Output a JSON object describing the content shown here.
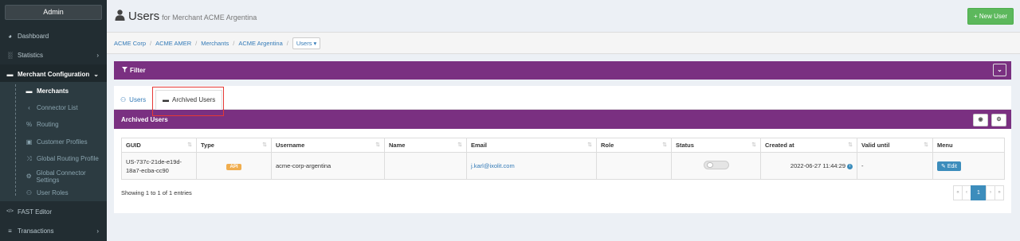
{
  "sidebar": {
    "admin_label": "Admin",
    "items": [
      {
        "label": "Dashboard",
        "icon": "dashboard-icon",
        "glyph": "◕"
      },
      {
        "label": "Statistics",
        "icon": "bar-chart-icon",
        "glyph": "░"
      },
      {
        "label": "Merchant Configuration",
        "icon": "folder-icon",
        "glyph": "▬"
      },
      {
        "label": "FAST Editor",
        "icon": "code-icon",
        "glyph": "</>"
      },
      {
        "label": "Transactions",
        "icon": "list-icon",
        "glyph": "≡"
      }
    ],
    "subitems": [
      {
        "label": "Merchants",
        "icon": "folder-icon",
        "glyph": "▬"
      },
      {
        "label": "Connector List",
        "icon": "share-icon",
        "glyph": "‹"
      },
      {
        "label": "Routing",
        "icon": "routing-icon",
        "glyph": "%"
      },
      {
        "label": "Customer Profiles",
        "icon": "id-card-icon",
        "glyph": "▣"
      },
      {
        "label": "Global Routing Profile",
        "icon": "random-icon",
        "glyph": "⤨"
      },
      {
        "label": "Global Connector Settings",
        "icon": "cog-icon",
        "glyph": "⚙"
      },
      {
        "label": "User Roles",
        "icon": "users-icon",
        "glyph": "⚇"
      }
    ]
  },
  "header": {
    "title": "Users",
    "subtitle": "for Merchant ACME Argentina",
    "new_user_label": "+ New User"
  },
  "breadcrumb": [
    "ACME Corp",
    "ACME AMER",
    "Merchants",
    "ACME Argentina"
  ],
  "breadcrumb_current": "Users ▾",
  "filter": {
    "label": "Filter"
  },
  "tabs": {
    "users": "Users",
    "archived": "Archived Users"
  },
  "section": {
    "title": "Archived Users"
  },
  "table": {
    "columns": [
      "GUID",
      "Type",
      "Username",
      "Name",
      "Email",
      "Role",
      "Status",
      "Created at",
      "Valid until",
      "Menu"
    ],
    "row": {
      "guid": "US-737c-21de-e19d-18a7-ecba-cc90",
      "type": "API",
      "username": "acme-corp-argentina",
      "name": "",
      "email": "j.karl@ixolit.com",
      "role": "",
      "created_at": "2022-06-27 11:44:29",
      "valid_until": "-",
      "edit_label": "Edit"
    }
  },
  "footer": {
    "entries_info": "Showing 1 to 1 of 1 entries",
    "pages": [
      "«",
      "‹",
      "1",
      "›",
      "»"
    ]
  },
  "colors": {
    "purple": "#7a3081",
    "sidebar": "#222d32",
    "green": "#5cb85c",
    "blue": "#3c8dbc"
  }
}
